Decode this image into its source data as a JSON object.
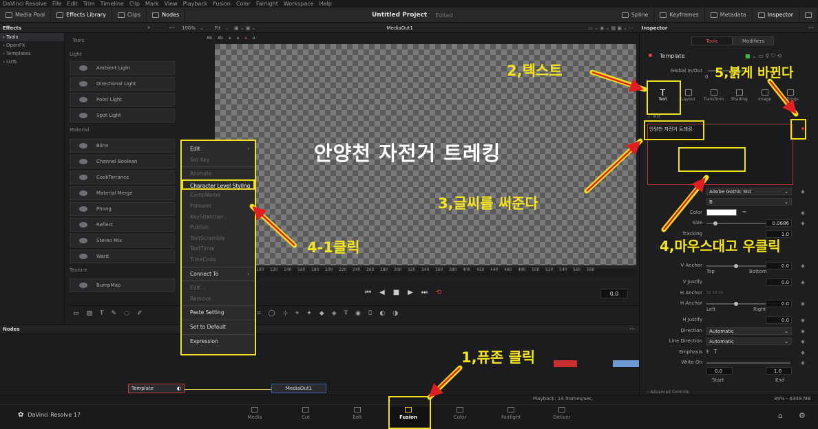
{
  "menubar": [
    "DaVinci Resolve",
    "File",
    "Edit",
    "Trim",
    "Timeline",
    "Clip",
    "Mark",
    "View",
    "Playback",
    "Fusion",
    "Color",
    "Fairlight",
    "Workspace",
    "Help"
  ],
  "toolbar": {
    "left": [
      "Media Pool",
      "Effects Library",
      "Clips",
      "Nodes"
    ],
    "right": [
      "Spline",
      "Keyframes",
      "Metadata",
      "Inspector"
    ]
  },
  "project": {
    "title": "Untitled Project",
    "state": "Edited"
  },
  "effects": {
    "header": "Effects",
    "tree": [
      "Tools",
      "OpenFX",
      "Templates",
      "LUTs"
    ],
    "tools_header": "Tools",
    "categories": [
      {
        "name": "Light",
        "items": [
          "Ambient Light",
          "Directional Light",
          "Point Light",
          "Spot Light"
        ]
      },
      {
        "name": "Material",
        "items": [
          "Blinn",
          "Channel Boolean",
          "CookTorrance",
          "Material Merge",
          "Phong",
          "Reflect",
          "Stereo Mix",
          "Ward"
        ]
      },
      {
        "name": "Texture",
        "items": [
          "BumpMap"
        ]
      }
    ]
  },
  "viewer": {
    "zoom": "100%",
    "fit": "Fit",
    "name": "MediaOut1",
    "canvas_text": "안양천 자전거 트레킹",
    "timecode": "0.0",
    "ruler": [
      "100",
      "120",
      "140",
      "160",
      "180",
      "200",
      "220",
      "240",
      "260",
      "280",
      "300",
      "320",
      "340",
      "360",
      "380",
      "400",
      "420",
      "440",
      "460",
      "480",
      "500",
      "520",
      "540",
      "560",
      "580"
    ]
  },
  "nodes": {
    "header": "Nodes",
    "template": "Template",
    "mediaout": "MediaOut1"
  },
  "status": {
    "playback": "Playback: 14 frames/sec.",
    "memory": "39% - 6349 MB"
  },
  "pages": {
    "brand": "DaVinci Resolve 17",
    "items": [
      "Media",
      "Cut",
      "Edit",
      "Fusion",
      "Color",
      "Fairlight",
      "Deliver"
    ],
    "active": "Fusion"
  },
  "inspector": {
    "header": "Inspector",
    "tabs": [
      "Tools",
      "Modifiers"
    ],
    "node": "Template",
    "global": "Global In/Out",
    "subtabs": [
      "Text",
      "Layout",
      "Transform",
      "Shading",
      "Image",
      "Settings"
    ],
    "section": "Text",
    "styled_text": "안양천 자전거 트레킹",
    "font": "Adobe Gothic Std",
    "style": "B",
    "labels": {
      "color": "Color",
      "size": "Size",
      "tracking": "Tracking",
      "vanchor": "V Anchor",
      "vjustify": "V Justify",
      "hanchor": "H Anchor",
      "hjustify": "H Justify",
      "direction": "Direction",
      "linedir": "Line Direction",
      "emphasis": "Emphasis",
      "writeon": "Write On",
      "top": "Top",
      "bottom": "Bottom",
      "left": "Left",
      "right": "Right",
      "start": "Start",
      "end": "End",
      "advanced": "Advanced Controls"
    },
    "values": {
      "size": "0.0686",
      "tracking": "1.0",
      "vanchor": "0.0",
      "vjustify": "0.0",
      "hanchor": "0.0",
      "hjustify": "0.0",
      "direction": "Automatic",
      "linedir": "Automatic",
      "writeon_start": "0.0",
      "writeon_end": "1.0"
    }
  },
  "context_menu": [
    "Edit",
    "Set Key",
    "Animate",
    "Character Level Styling",
    "CompName",
    "Follower",
    "KeyStretcher",
    "Publish",
    "TextScramble",
    "TextTimer",
    "TimeCode",
    "Connect To",
    "Edit...",
    "Remove",
    "Paste Setting",
    "Set to Default",
    "Expression"
  ],
  "annotations": {
    "step1": "1,퓨존 클릭",
    "step2": "2,텍스트",
    "step3": "3,글씨를 써준다",
    "step4": "4,마우스대고 우클릭",
    "step41": "4-1클릭",
    "step5": "5,붉게 바뀐다"
  },
  "colors": {
    "annotation": "#f5e51c",
    "highlight": "#f0e020",
    "accent_red": "#e05252"
  }
}
